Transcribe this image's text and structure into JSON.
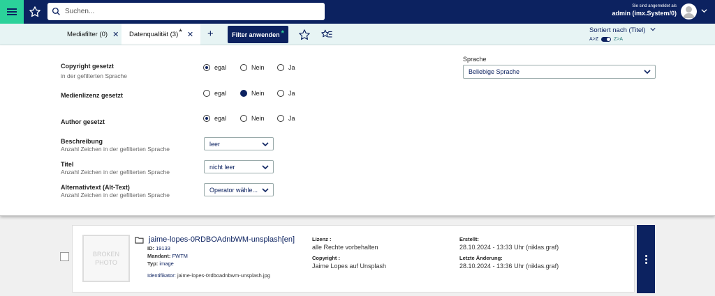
{
  "header": {
    "search_placeholder": "Suchen...",
    "logged_in_text": "Sie sind angemeldet als",
    "user_name": "admin (imx.System/0)"
  },
  "tabs": [
    {
      "label": "Mediafilter (0)"
    },
    {
      "label": "Datenqualität (3)",
      "modified": "*"
    }
  ],
  "toolbar": {
    "apply_label": "Filter anwenden",
    "apply_modified": "*",
    "sort_label": "Sortiert nach (Titel)",
    "sort_az": "A>Z",
    "sort_za": "Z>A"
  },
  "filters": {
    "copyright": {
      "label": "Copyright gesetzt",
      "sub": "in der gefilterten Sprache",
      "options": [
        "egal",
        "Nein",
        "Ja"
      ],
      "selected": "egal"
    },
    "license": {
      "label": "Medienlizenz gesetzt",
      "options": [
        "egal",
        "Nein",
        "Ja"
      ],
      "selected": "Nein"
    },
    "author": {
      "label": "Author gesetzt",
      "options": [
        "egal",
        "Nein",
        "Ja"
      ],
      "selected": "egal"
    },
    "description": {
      "label": "Beschreibung",
      "sub": "Anzahl Zeichen in der gefilterten Sprache",
      "value": "leer"
    },
    "title": {
      "label": "Titel",
      "sub": "Anzahl Zeichen in der gefilterten Sprache",
      "value": "nicht leer"
    },
    "alttext": {
      "label": "Alternativtext (Alt-Text)",
      "sub": "Anzahl Zeichen in der gefilterten Sprache",
      "value": "Operator wähle..."
    },
    "language": {
      "label": "Sprache",
      "value": "Beliebige Sprache"
    }
  },
  "result": {
    "thumb_text": "BROKEN PHOTO",
    "title": "jaime-lopes-0RDBOAdnbWM-unsplash[en]",
    "id_label": "ID:",
    "id_value": "19133",
    "mandant_label": "Mandant:",
    "mandant_value": "FWTM",
    "type_label": "Typ:",
    "type_value": "image",
    "identifier_label": "Identifikator:",
    "identifier_value": "jaime-lopes-0rdboadnbwm-unsplash.jpg",
    "license_label": "Lizenz :",
    "license_value": "alle Rechte vorbehalten",
    "copyright_label": "Copyright :",
    "copyright_value": "Jaime Lopes auf Unsplash",
    "created_label": "Erstellt:",
    "created_value": "28.10.2024 - 13:33 Uhr (niklas.graf)",
    "changed_label": "Letzte Änderung:",
    "changed_value": "28.10.2024 - 13:36 Uhr (niklas.graf)"
  },
  "colors": {
    "primary": "#0c2260",
    "accent": "#2bd29a",
    "toolbar_bg": "#e7f4f4"
  }
}
